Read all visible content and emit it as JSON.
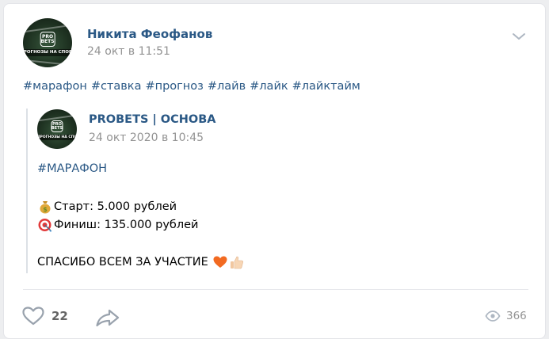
{
  "post": {
    "author": "Никита Феофанов",
    "time": "24 окт в 11:51",
    "avatar_text": {
      "top1": "PRO",
      "top2": "BETS",
      "band": "ПРОГНОЗЫ НА СПОРТ"
    },
    "hashtags": [
      "#марафон",
      "#ставка",
      "#прогноз",
      "#лайв",
      "#лайк",
      "#лайктайм"
    ]
  },
  "repost": {
    "group": "PROBETS | ОСНОВА",
    "time": "24 окт 2020 в 10:45",
    "avatar_text": {
      "top1": "PRO",
      "top2": "BETS",
      "band": "ПРОГНОЗЫ НА СПО"
    },
    "tag": "#МАРАФОН",
    "start_text": "Старт: 5.000 рублей",
    "finish_text": "Финиш: 135.000 рублей",
    "thanks_text": "СПАСИБО ВСЕМ ЗА УЧАСТИЕ"
  },
  "footer": {
    "likes": "22",
    "views": "366"
  },
  "colors": {
    "link": "#2a5885",
    "muted": "#939393",
    "icon": "#aeb7c2"
  },
  "icons": [
    "chevron-down-icon",
    "money-bag-icon",
    "target-icon",
    "heart-emoji-icon",
    "thumbs-up-icon",
    "heart-outline-icon",
    "share-arrow-icon",
    "eye-icon"
  ]
}
